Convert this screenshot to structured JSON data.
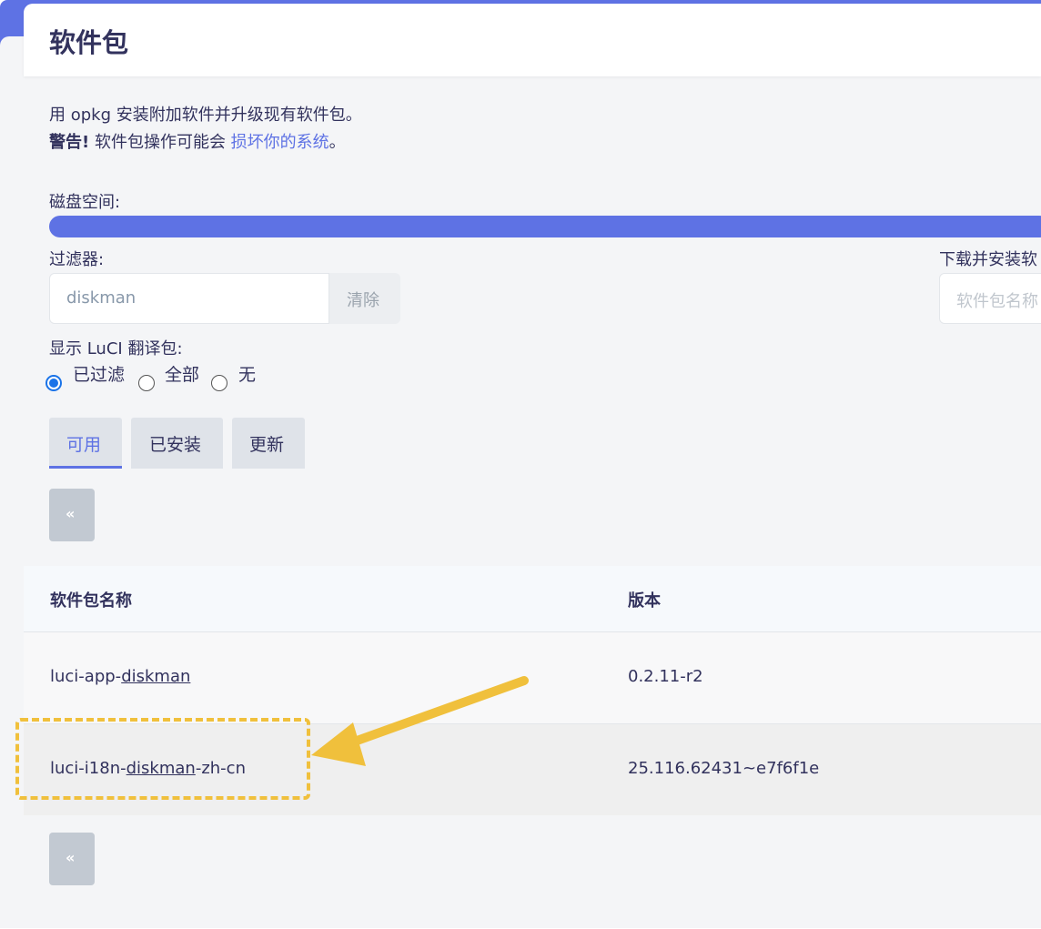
{
  "page": {
    "title": "软件包",
    "intro_line1": "用 opkg 安装附加软件并升级现有软件包。",
    "warning_bold": "警告!",
    "warning_text": " 软件包操作可能会 ",
    "warning_link": "损坏你的系统",
    "warning_end": "。"
  },
  "disk": {
    "label": "磁盘空间:"
  },
  "filter": {
    "label": "过滤器:",
    "value": "diskman",
    "clear_label": "清除"
  },
  "download": {
    "label": "下载并安装软",
    "placeholder": "软件包名称"
  },
  "luci": {
    "label": "显示 LuCI 翻译包:",
    "options": [
      "已过滤",
      "全部",
      "无"
    ],
    "selected": "已过滤"
  },
  "tabs": [
    "可用",
    "已安装",
    "更新"
  ],
  "pager": {
    "prev": "«"
  },
  "table": {
    "headers": [
      "软件包名称",
      "版本"
    ],
    "rows": [
      {
        "name_pre": "luci-app-",
        "name_match": "diskman",
        "name_post": "",
        "version": "0.2.11-r2"
      },
      {
        "name_pre": "luci-i18n-",
        "name_match": "diskman",
        "name_post": "-zh-cn",
        "version": "25.116.62431~e7f6f1e"
      }
    ]
  },
  "colors": {
    "accent": "#5e72e4",
    "annotation": "#f0c03c"
  }
}
